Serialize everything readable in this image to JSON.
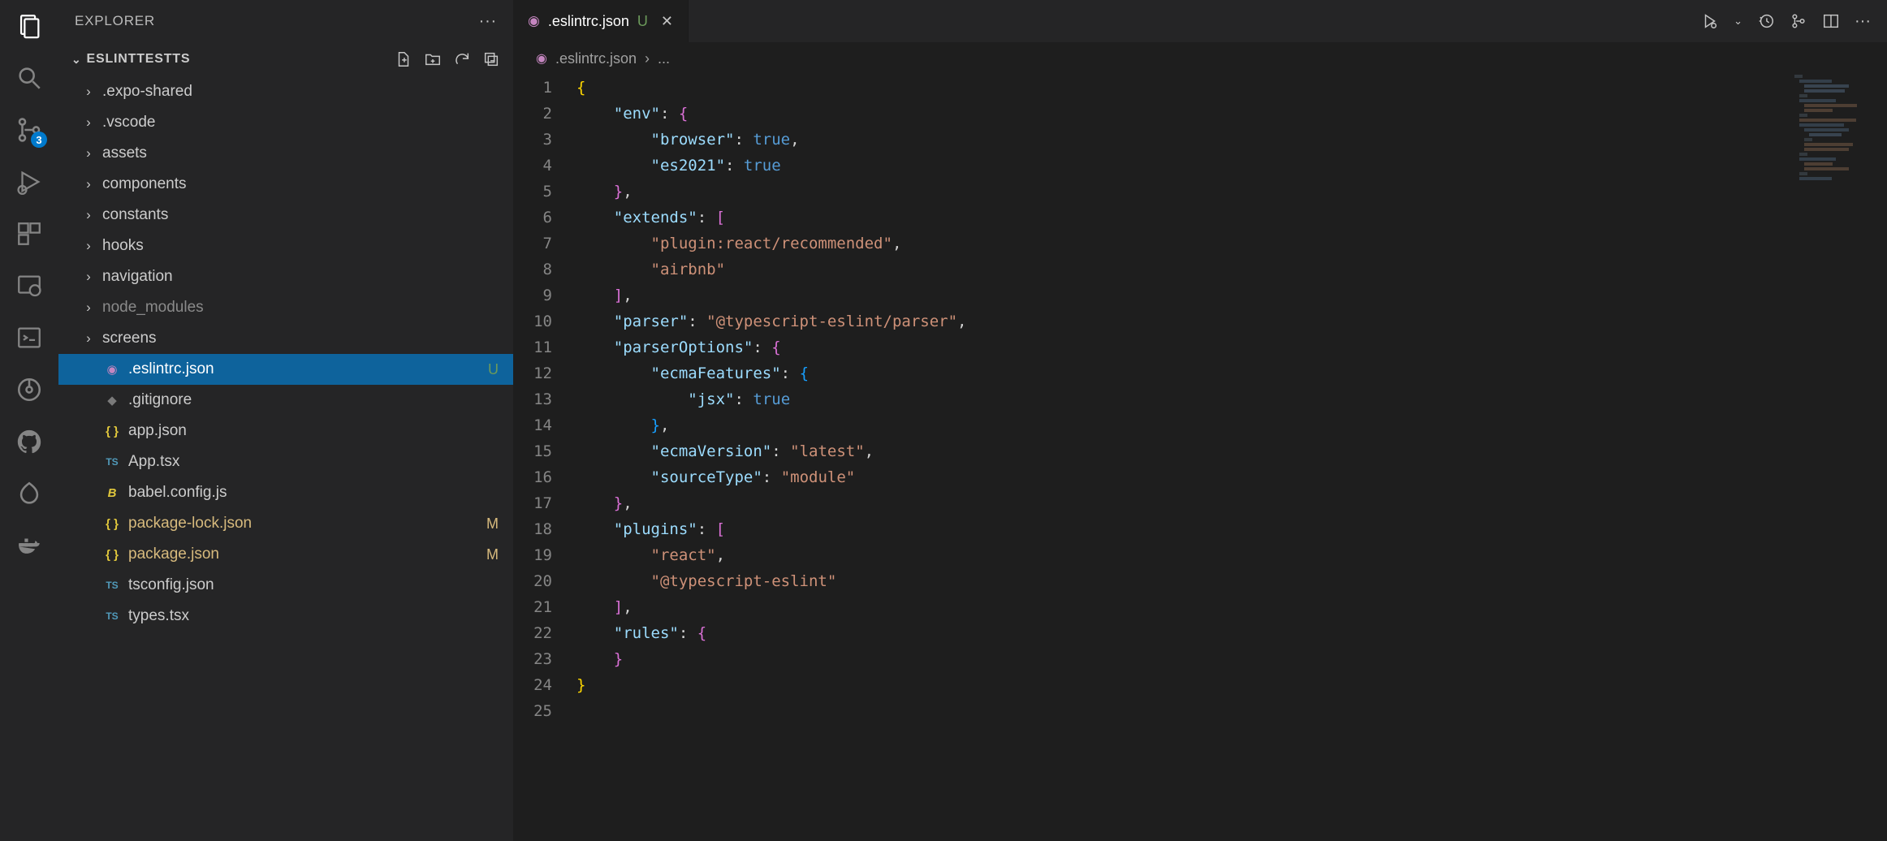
{
  "sidebar": {
    "title": "EXPLORER",
    "project": "ESLINTTESTTS"
  },
  "activityBar": {
    "scmBadge": "3"
  },
  "fileTree": {
    "folders": [
      {
        "name": ".expo-shared"
      },
      {
        "name": ".vscode"
      },
      {
        "name": "assets"
      },
      {
        "name": "components"
      },
      {
        "name": "constants"
      },
      {
        "name": "hooks"
      },
      {
        "name": "navigation"
      },
      {
        "name": "node_modules",
        "dim": true
      },
      {
        "name": "screens"
      }
    ],
    "files": [
      {
        "name": ".eslintrc.json",
        "iconColor": "purple",
        "glyph": "◉",
        "git": "U",
        "selected": true
      },
      {
        "name": ".gitignore",
        "iconColor": "git",
        "glyph": "◆"
      },
      {
        "name": "app.json",
        "iconColor": "brace",
        "glyph": "{ }"
      },
      {
        "name": "App.tsx",
        "iconColor": "blue",
        "glyph": "TS"
      },
      {
        "name": "babel.config.js",
        "iconColor": "yellow",
        "glyph": "B",
        "italic": true
      },
      {
        "name": "package-lock.json",
        "iconColor": "brace",
        "glyph": "{ }",
        "git": "M"
      },
      {
        "name": "package.json",
        "iconColor": "brace",
        "glyph": "{ }",
        "git": "M"
      },
      {
        "name": "tsconfig.json",
        "iconColor": "blue",
        "glyph": "TS"
      },
      {
        "name": "types.tsx",
        "iconColor": "blue",
        "glyph": "TS"
      }
    ]
  },
  "tab": {
    "icon": "◉",
    "name": ".eslintrc.json",
    "modifier": "U"
  },
  "breadcrumb": {
    "icon": "◉",
    "file": ".eslintrc.json",
    "sep": "›",
    "rest": "..."
  },
  "code": {
    "lineStart": 1,
    "lineEnd": 25,
    "content": {
      "env": {
        "browser": true,
        "es2021": true
      },
      "extends": [
        "plugin:react/recommended",
        "airbnb"
      ],
      "parser": "@typescript-eslint/parser",
      "parserOptions": {
        "ecmaFeatures": {
          "jsx": true
        },
        "ecmaVersion": "latest",
        "sourceType": "module"
      },
      "plugins": [
        "react",
        "@typescript-eslint"
      ],
      "rules": {}
    }
  }
}
